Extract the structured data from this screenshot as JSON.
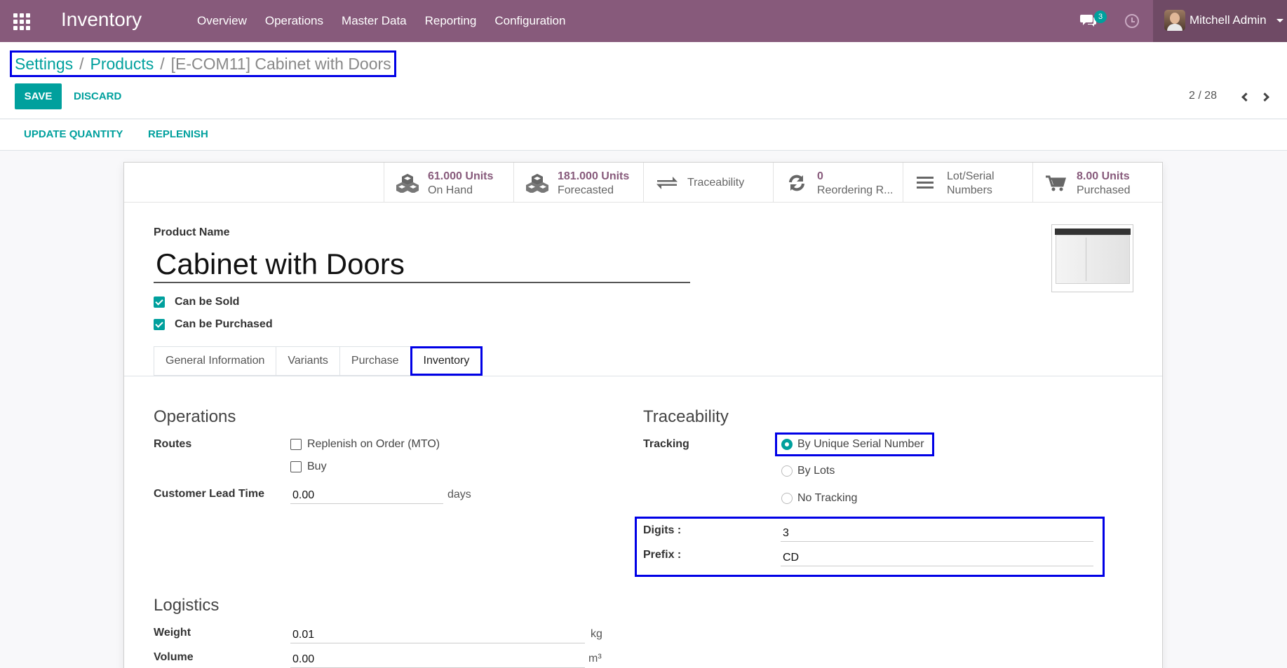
{
  "navbar": {
    "app_name": "Inventory",
    "menu": [
      "Overview",
      "Operations",
      "Master Data",
      "Reporting",
      "Configuration"
    ],
    "chat_count": "3",
    "user_name": "Mitchell Admin",
    "color": "#875a7b"
  },
  "breadcrumb": {
    "items": [
      "Settings",
      "Products"
    ],
    "separator": "/",
    "current": "[E-COM11] Cabinet with Doors"
  },
  "actions": {
    "save": "SAVE",
    "discard": "DISCARD"
  },
  "pager": {
    "value": "2 / 28"
  },
  "status_buttons": {
    "update_quantity": "UPDATE QUANTITY",
    "replenish": "REPLENISH"
  },
  "smart_buttons": [
    {
      "icon": "cubes-icon",
      "value": "61.000 Units",
      "label": "On Hand"
    },
    {
      "icon": "cubes-icon",
      "value": "181.000 Units",
      "label": "Forecasted"
    },
    {
      "icon": "exchange-icon",
      "value": "",
      "label": "Traceability"
    },
    {
      "icon": "refresh-icon",
      "value": "0",
      "label": "Reordering R..."
    },
    {
      "icon": "list-icon",
      "value": "",
      "label": "Lot/Serial",
      "label2": "Numbers"
    },
    {
      "icon": "cart-icon",
      "value": "8.00 Units",
      "label": "Purchased"
    }
  ],
  "form": {
    "product_name_label": "Product Name",
    "product_name": "Cabinet with Doors",
    "can_be_sold": "Can be Sold",
    "can_be_purchased": "Can be Purchased",
    "tabs": [
      "General Information",
      "Variants",
      "Purchase",
      "Inventory"
    ],
    "active_tab": "Inventory",
    "operations": {
      "title": "Operations",
      "routes_label": "Routes",
      "routes": [
        "Replenish on Order (MTO)",
        "Buy"
      ],
      "lead_time_label": "Customer Lead Time",
      "lead_time": "0.00",
      "lead_time_unit": "days"
    },
    "traceability": {
      "title": "Traceability",
      "tracking_label": "Tracking",
      "options": [
        "By Unique Serial Number",
        "By Lots",
        "No Tracking"
      ],
      "selected": "By Unique Serial Number",
      "digits_label": "Digits :",
      "digits": "3",
      "prefix_label": "Prefix :",
      "prefix": "CD"
    },
    "logistics": {
      "title": "Logistics",
      "weight_label": "Weight",
      "weight": "0.01",
      "weight_unit": "kg",
      "volume_label": "Volume",
      "volume": "0.00",
      "volume_unit": "m³"
    }
  }
}
